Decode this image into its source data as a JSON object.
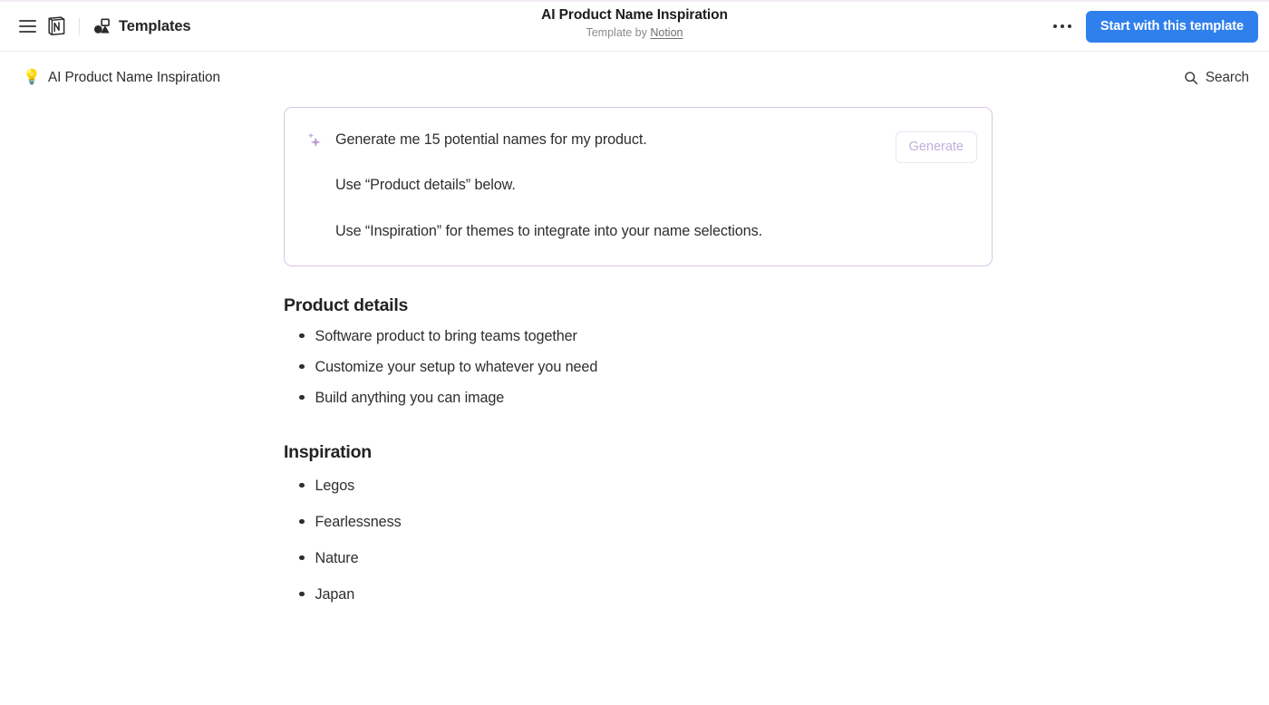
{
  "window": {
    "accent_blue": "#2f80ed",
    "card_border_purple": "#d8c6e6",
    "sparkle_purple": "#b99ed4"
  },
  "topbar": {
    "menu_icon": "hamburger-icon",
    "logo_icon": "notion-logo-icon",
    "templates_icon": "shapes-icon",
    "templates_label": "Templates",
    "title": "AI Product Name Inspiration",
    "subtitle_prefix": "Template by ",
    "subtitle_author": "Notion",
    "more_icon": "ellipsis-icon",
    "cta_label": "Start with this template"
  },
  "breadcrumb": {
    "emoji": "💡",
    "label": "AI Product Name Inspiration",
    "search_icon": "search-icon",
    "search_label": "Search"
  },
  "ai_card": {
    "sparkle_icon": "sparkles-icon",
    "generate_label": "Generate",
    "lines": [
      "Generate me 15 potential names for my product.",
      "Use “Product details” below.",
      "Use “Inspiration” for themes to integrate into your name selections."
    ]
  },
  "sections": [
    {
      "title": "Product details",
      "items": [
        "Software product to bring teams together",
        "Customize your setup to whatever you need",
        "Build anything you can image"
      ]
    },
    {
      "title": "Inspiration",
      "items": [
        "Legos",
        "Fearlessness",
        "Nature",
        "Japan"
      ]
    }
  ]
}
